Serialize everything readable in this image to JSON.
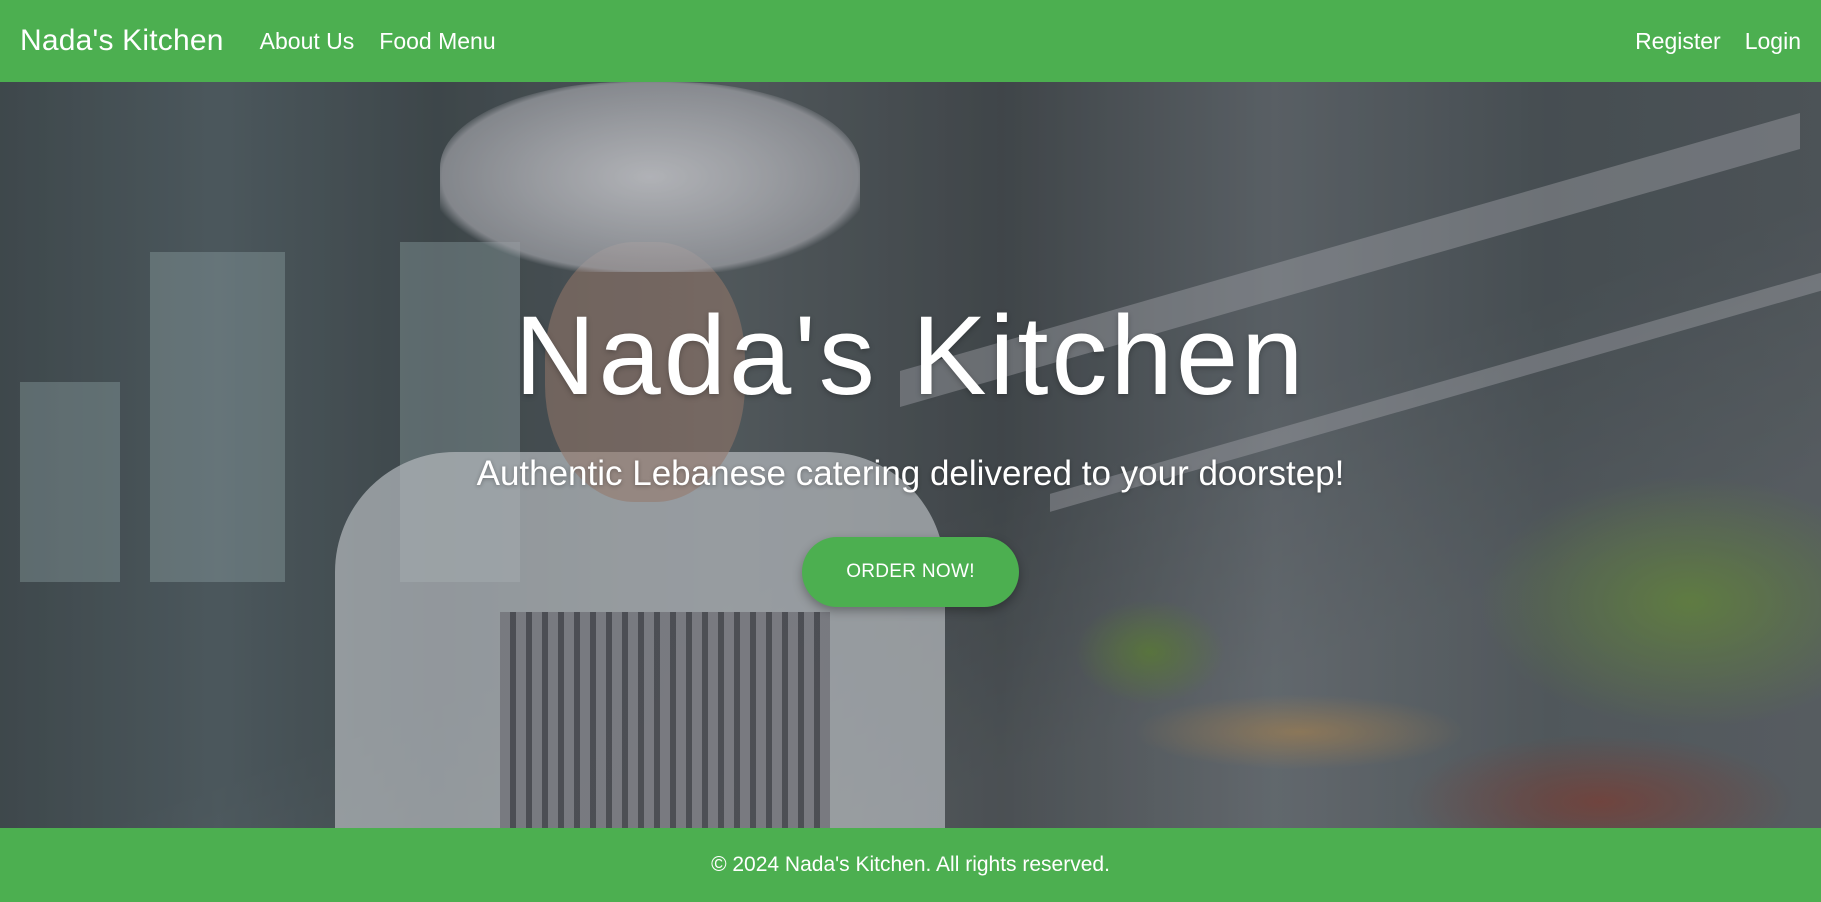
{
  "nav": {
    "brand": "Nada's Kitchen",
    "links": [
      "About Us",
      "Food Menu"
    ],
    "right_links": [
      "Register",
      "Login"
    ]
  },
  "hero": {
    "title": "Nada's Kitchen",
    "subtitle": "Authentic Lebanese catering delivered to your doorstep!",
    "cta_label": "ORDER NOW!"
  },
  "footer": {
    "text": "© 2024 Nada's Kitchen. All rights reserved."
  },
  "colors": {
    "brand_green": "#4caf50",
    "text": "#ffffff"
  }
}
